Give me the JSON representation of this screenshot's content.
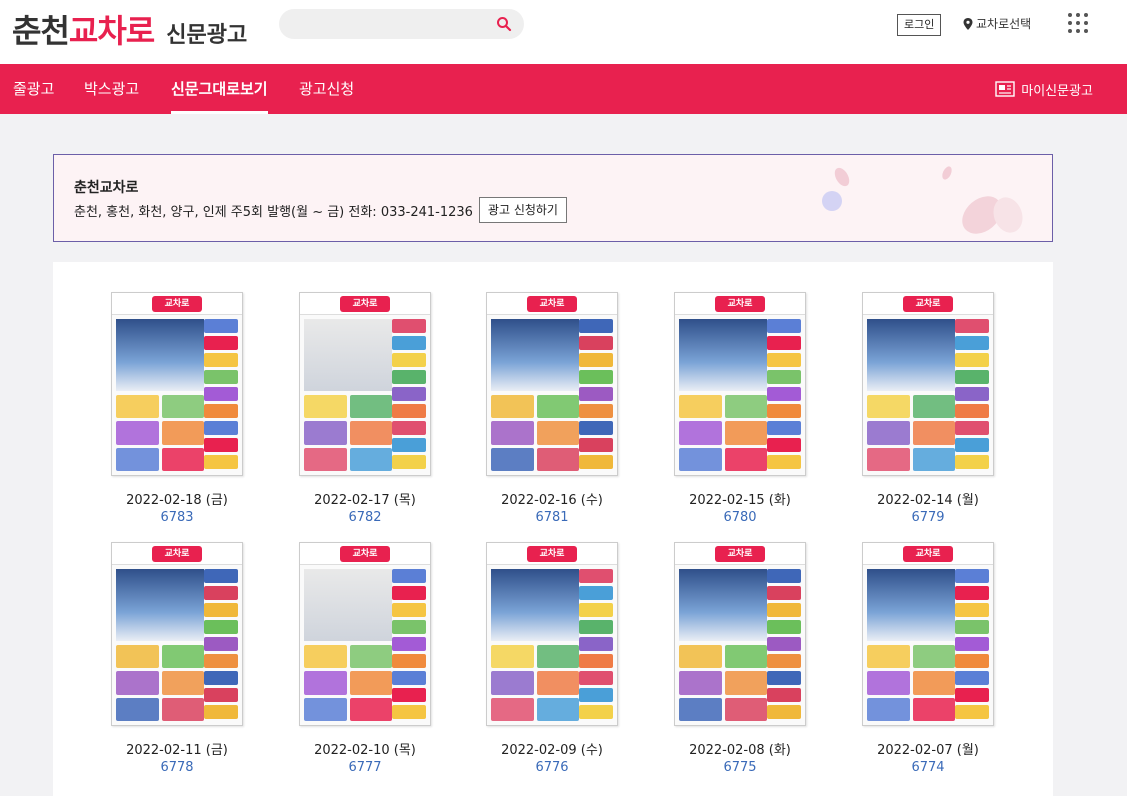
{
  "header": {
    "logo_part1": "춘천",
    "logo_part2": "교차로",
    "logo_part3": "신문광고",
    "search_placeholder": "",
    "login_label": "로그인",
    "region_label": "교차로선택"
  },
  "nav": {
    "items": [
      {
        "label": "줄광고"
      },
      {
        "label": "박스광고"
      },
      {
        "label": "신문그대로보기"
      },
      {
        "label": "광고신청"
      }
    ],
    "my_ad_label": "마이신문광고"
  },
  "info": {
    "title": "춘천교차로",
    "description": "춘천, 홍천, 화천, 양구, 인제 주5회 발행(월 ~ 금) 전화: 033-241-1236",
    "apply_label": "광고 신청하기"
  },
  "thumb_logo": "교차로",
  "issues": [
    {
      "date": "2022-02-18 (금)",
      "number": "6783"
    },
    {
      "date": "2022-02-17 (목)",
      "number": "6782"
    },
    {
      "date": "2022-02-16 (수)",
      "number": "6781"
    },
    {
      "date": "2022-02-15 (화)",
      "number": "6780"
    },
    {
      "date": "2022-02-14 (월)",
      "number": "6779"
    },
    {
      "date": "2022-02-11 (금)",
      "number": "6778"
    },
    {
      "date": "2022-02-10 (목)",
      "number": "6777"
    },
    {
      "date": "2022-02-09 (수)",
      "number": "6776"
    },
    {
      "date": "2022-02-08 (화)",
      "number": "6775"
    },
    {
      "date": "2022-02-07 (월)",
      "number": "6774"
    }
  ],
  "colors": {
    "brand": "#e8214f",
    "number_link": "#3a6ab8",
    "info_border": "#6c5fa8"
  }
}
